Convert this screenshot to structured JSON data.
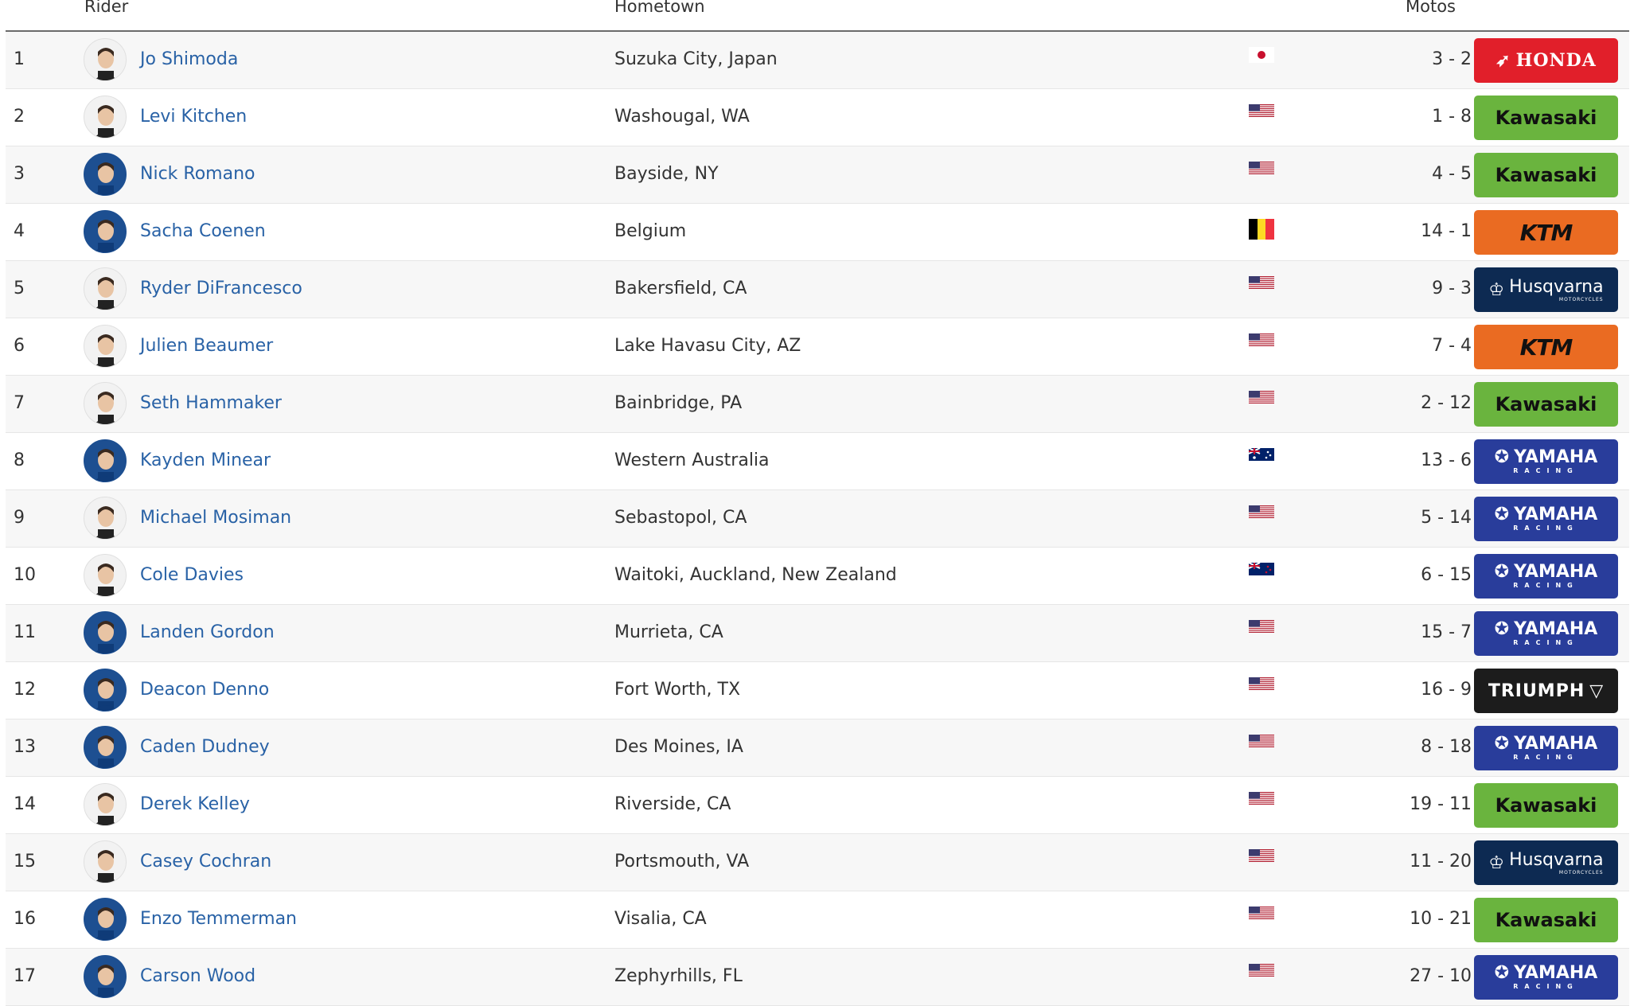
{
  "columns": {
    "rider": "Rider",
    "hometown": "Hometown",
    "motos": "Motos"
  },
  "brand_labels": {
    "honda": "HONDA",
    "kawasaki": "Kawasaki",
    "ktm": "KTM",
    "husqvarna": "Husqvarna",
    "husqvarna_sub": "MOTORCYCLES",
    "yamaha": "YAMAHA",
    "yamaha_sub": "RACING",
    "triumph": "TRIUMPH"
  },
  "colors": {
    "link": "#2962a6",
    "honda": "#e11f2a",
    "kawasaki": "#6ab43e",
    "ktm": "#ea6b22",
    "husqvarna": "#0d2a52",
    "yamaha": "#293d9b",
    "triumph": "#1c1c1c"
  },
  "rows": [
    {
      "pos": "1",
      "rider": "Jo Shimoda",
      "hometown": "Suzuka City, Japan",
      "flag": "jp-flag",
      "motos": "3 - 2",
      "brand": "honda",
      "avatar": "light"
    },
    {
      "pos": "2",
      "rider": "Levi Kitchen",
      "hometown": "Washougal, WA",
      "flag": "us-flag",
      "motos": "1 - 8",
      "brand": "kawasaki",
      "avatar": "light"
    },
    {
      "pos": "3",
      "rider": "Nick Romano",
      "hometown": "Bayside, NY",
      "flag": "us-flag",
      "motos": "4 - 5",
      "brand": "kawasaki",
      "avatar": "blue"
    },
    {
      "pos": "4",
      "rider": "Sacha Coenen",
      "hometown": "Belgium",
      "flag": "be-flag",
      "motos": "14 - 1",
      "brand": "ktm",
      "avatar": "blue"
    },
    {
      "pos": "5",
      "rider": "Ryder DiFrancesco",
      "hometown": "Bakersfield, CA",
      "flag": "us-flag",
      "motos": "9 - 3",
      "brand": "husqvarna",
      "avatar": "light"
    },
    {
      "pos": "6",
      "rider": "Julien Beaumer",
      "hometown": "Lake Havasu City, AZ",
      "flag": "us-flag",
      "motos": "7 - 4",
      "brand": "ktm",
      "avatar": "light"
    },
    {
      "pos": "7",
      "rider": "Seth Hammaker",
      "hometown": "Bainbridge, PA",
      "flag": "us-flag",
      "motos": "2 - 12",
      "brand": "kawasaki",
      "avatar": "light"
    },
    {
      "pos": "8",
      "rider": "Kayden Minear",
      "hometown": "Western Australia",
      "flag": "au-flag",
      "motos": "13 - 6",
      "brand": "yamaha",
      "avatar": "blue"
    },
    {
      "pos": "9",
      "rider": "Michael Mosiman",
      "hometown": "Sebastopol, CA",
      "flag": "us-flag",
      "motos": "5 - 14",
      "brand": "yamaha",
      "avatar": "light"
    },
    {
      "pos": "10",
      "rider": "Cole Davies",
      "hometown": "Waitoki, Auckland, New Zealand",
      "flag": "nz-flag",
      "motos": "6 - 15",
      "brand": "yamaha",
      "avatar": "light"
    },
    {
      "pos": "11",
      "rider": "Landen Gordon",
      "hometown": "Murrieta, CA",
      "flag": "us-flag",
      "motos": "15 - 7",
      "brand": "yamaha",
      "avatar": "blue"
    },
    {
      "pos": "12",
      "rider": "Deacon Denno",
      "hometown": "Fort Worth, TX",
      "flag": "us-flag",
      "motos": "16 - 9",
      "brand": "triumph",
      "avatar": "blue"
    },
    {
      "pos": "13",
      "rider": "Caden Dudney",
      "hometown": "Des Moines, IA",
      "flag": "us-flag",
      "motos": "8 - 18",
      "brand": "yamaha",
      "avatar": "blue"
    },
    {
      "pos": "14",
      "rider": "Derek Kelley",
      "hometown": "Riverside, CA",
      "flag": "us-flag",
      "motos": "19 - 11",
      "brand": "kawasaki",
      "avatar": "light"
    },
    {
      "pos": "15",
      "rider": "Casey Cochran",
      "hometown": "Portsmouth, VA",
      "flag": "us-flag",
      "motos": "11 - 20",
      "brand": "husqvarna",
      "avatar": "light"
    },
    {
      "pos": "16",
      "rider": "Enzo Temmerman",
      "hometown": "Visalia, CA",
      "flag": "us-flag",
      "motos": "10 - 21",
      "brand": "kawasaki",
      "avatar": "blue"
    },
    {
      "pos": "17",
      "rider": "Carson Wood",
      "hometown": "Zephyrhills, FL",
      "flag": "us-flag",
      "motos": "27 - 10",
      "brand": "yamaha",
      "avatar": "blue"
    }
  ]
}
